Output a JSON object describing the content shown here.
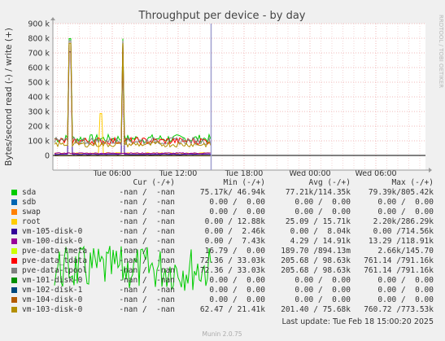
{
  "chart_data": {
    "type": "line",
    "title": "Throughput per device - by day",
    "ylabel": "Bytes/second read (-) / write (+)",
    "y_ticks": [
      "900 k",
      "800 k",
      "700 k",
      "600 k",
      "500 k",
      "400 k",
      "300 k",
      "200 k",
      "100 k",
      "0"
    ],
    "x_ticks": [
      "Tue 06:00",
      "Tue 12:00",
      "Tue 18:00",
      "Wed 00:00",
      "Wed 06:00"
    ],
    "ylim": [
      -100000,
      900000
    ],
    "grid": true,
    "watermark": "RRDTOOL / TOBI OETIKER",
    "legend_headers": {
      "cur": "Cur (-/+)",
      "min": "Min (-/+)",
      "avg": "Avg (-/+)",
      "max": "Max (-/+)"
    },
    "series": [
      {
        "name": "sda",
        "color": "#00cc00",
        "cur": "-nan /  -nan",
        "min": "75.17k/ 46.94k",
        "avg": "77.21k/114.35k",
        "max": "79.39k/805.42k"
      },
      {
        "name": "sdb",
        "color": "#0066b3",
        "cur": "-nan /  -nan",
        "min": "0.00 /  0.00",
        "avg": "0.00 /  0.00",
        "max": "0.00 /  0.00"
      },
      {
        "name": "swap",
        "color": "#ff8000",
        "cur": "-nan /  -nan",
        "min": "0.00 /  0.00",
        "avg": "0.00 /  0.00",
        "max": "0.00 /  0.00"
      },
      {
        "name": "root",
        "color": "#ffcc00",
        "cur": "-nan /  -nan",
        "min": "0.00 / 12.88k",
        "avg": "25.09 / 15.71k",
        "max": "2.20k/286.29k"
      },
      {
        "name": "vm-105-disk-0",
        "color": "#330099",
        "cur": "-nan /  -nan",
        "min": "0.00 /  2.46k",
        "avg": "0.00 /  8.04k",
        "max": "0.00 /714.56k"
      },
      {
        "name": "vm-100-disk-0",
        "color": "#990099",
        "cur": "-nan /  -nan",
        "min": "0.00 /  7.43k",
        "avg": "4.29 / 14.91k",
        "max": "13.29 /118.91k"
      },
      {
        "name": "pve-data_tmeta",
        "color": "#ccff00",
        "cur": "-nan /  -nan",
        "min": "16.79 /  0.00",
        "avg": "189.70 /894.13m",
        "max": "2.66k/145.70"
      },
      {
        "name": "pve-data_tdata",
        "color": "#ff0000",
        "cur": "-nan /  -nan",
        "min": "72.36 / 33.03k",
        "avg": "205.68 / 98.63k",
        "max": "761.14 /791.16k"
      },
      {
        "name": "pve-data-tpool",
        "color": "#808080",
        "cur": "-nan /  -nan",
        "min": "72.36 / 33.03k",
        "avg": "205.68 / 98.63k",
        "max": "761.14 /791.16k"
      },
      {
        "name": "vm-101-disk-0",
        "color": "#008f00",
        "cur": "-nan /  -nan",
        "min": "0.00 /  0.00",
        "avg": "0.00 /  0.00",
        "max": "0.00 /  0.00"
      },
      {
        "name": "vm-102-disk-1",
        "color": "#00487d",
        "cur": "-nan /  -nan",
        "min": "0.00 /  0.00",
        "avg": "0.00 /  0.00",
        "max": "0.00 /  0.00"
      },
      {
        "name": "vm-104-disk-0",
        "color": "#b35a00",
        "cur": "-nan /  -nan",
        "min": "0.00 /  0.00",
        "avg": "0.00 /  0.00",
        "max": "0.00 /  0.00"
      },
      {
        "name": "vm-103-disk-0",
        "color": "#b38f00",
        "cur": "-nan /  -nan",
        "min": "62.47 / 21.41k",
        "avg": "201.40 / 75.68k",
        "max": "760.72 /773.53k"
      }
    ],
    "last_update": "Last update: Tue Feb 18 15:00:20 2025",
    "footer": "Munin 2.0.75"
  }
}
